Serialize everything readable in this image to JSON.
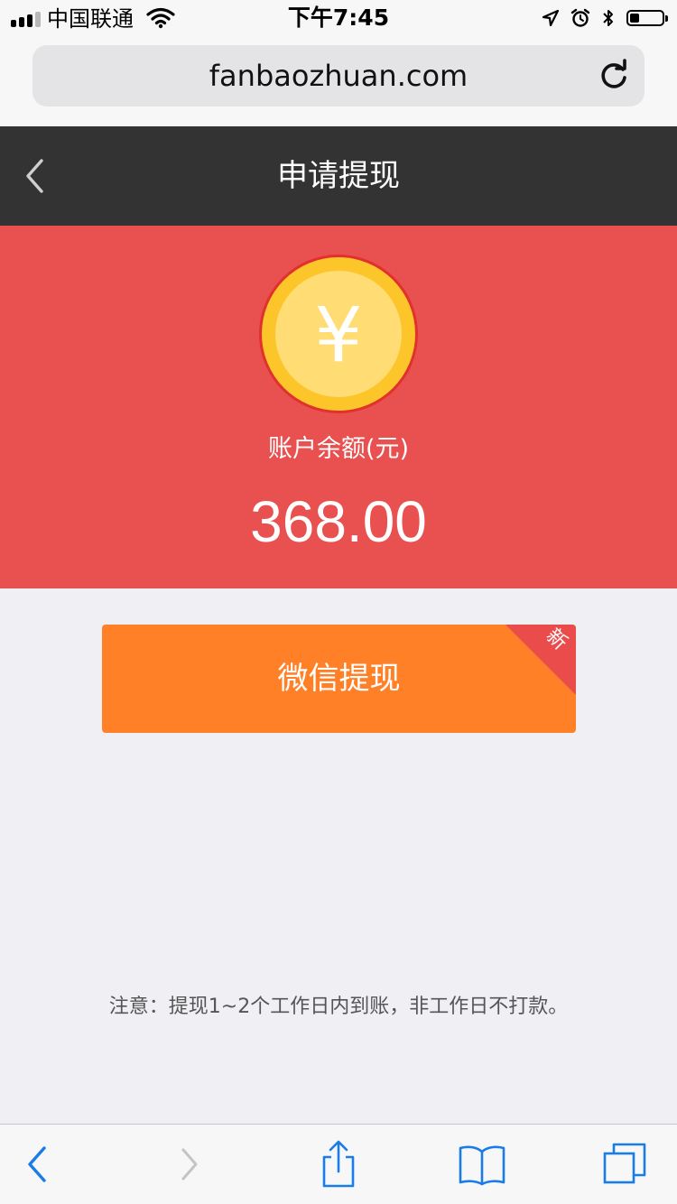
{
  "status_bar": {
    "carrier": "中国联通",
    "time": "下午7:45",
    "battery_level": 0.3
  },
  "browser": {
    "url": "fanbaozhuan.com"
  },
  "header": {
    "title": "申请提现"
  },
  "balance": {
    "currency_symbol": "¥",
    "label": "账户余额(元)",
    "amount": "368.00"
  },
  "withdraw": {
    "wechat_label": "微信提现",
    "badge": "新"
  },
  "notice": "注意：提现1~2个工作日内到账，非工作日不打款。",
  "colors": {
    "header_bg": "#333333",
    "balance_bg": "#e95050",
    "button_bg": "#ff8027",
    "coin_outer": "#fcc52a",
    "coin_inner": "#ffdd74",
    "ios_blue": "#1a7ce6"
  },
  "toolbar": {
    "icons": [
      "back-arrow-icon",
      "forward-arrow-icon",
      "share-icon",
      "bookmarks-icon",
      "tabs-icon"
    ]
  }
}
